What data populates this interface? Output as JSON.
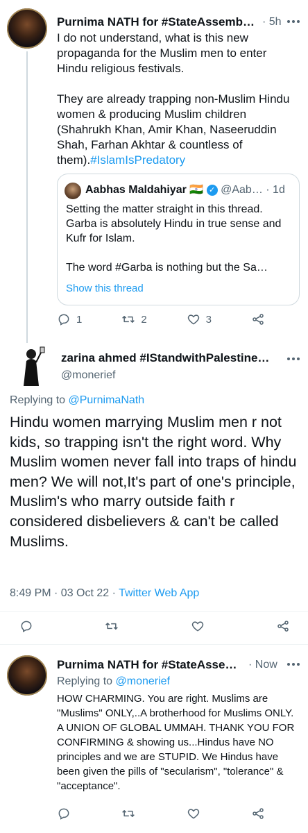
{
  "tweet1": {
    "author": "Purnima NATH for #StateAssemb…",
    "time": "5h",
    "para1": "I do not understand, what is this new propaganda for the Muslim men to enter Hindu religious festivals.",
    "para2_text": "They are already trapping non-Muslim Hindu women & producing Muslim children (Shahrukh Khan, Amir Khan, Naseeruddin Shah, Farhan Akhtar & countless of them).",
    "hashtag": "#IslamIsPredatory",
    "quote": {
      "author": "Aabhas Maldahiyar",
      "flag": "🇮🇳",
      "handle": "@Aab…",
      "time": "· 1d",
      "line1": "Setting the matter straight in this thread. Garba is absolutely Hindu in true sense and Kufr for Islam.",
      "line2": "The word #Garba  is nothing but the Sa…",
      "show_thread": "Show this thread"
    },
    "replies": "1",
    "retweets": "2",
    "likes": "3"
  },
  "tweet2": {
    "author": "zarina ahmed #IStandwithPalestine…",
    "handle": "@monerief",
    "replying_prefix": "Replying to ",
    "replying_to": "@PurnimaNath",
    "text": "Hindu women marrying Muslim men r not kids, so trapping isn't the right word. Why Muslim women never fall into traps of hindu men? We will not,It's part of one's principle, Muslim's who marry outside faith r considered disbelievers & can't be called Muslims.",
    "timestamp": "8:49 PM · 03 Oct 22 · ",
    "source": "Twitter Web App"
  },
  "tweet3": {
    "author": "Purnima NATH for #StateAsse…",
    "time": "· Now",
    "replying_prefix": "Replying to ",
    "replying_to": "@monerief",
    "text": "HOW CHARMING. You are right. Muslims are \"Muslims\" ONLY,..A brotherhood for Muslims ONLY. A UNION OF GLOBAL UMMAH. THANK YOU FOR CONFIRMING & showing us...Hindus have NO principles and we are STUPID. We Hindus have been given the pills of \"secularism\", \"tolerance\" & \"acceptance\"."
  }
}
